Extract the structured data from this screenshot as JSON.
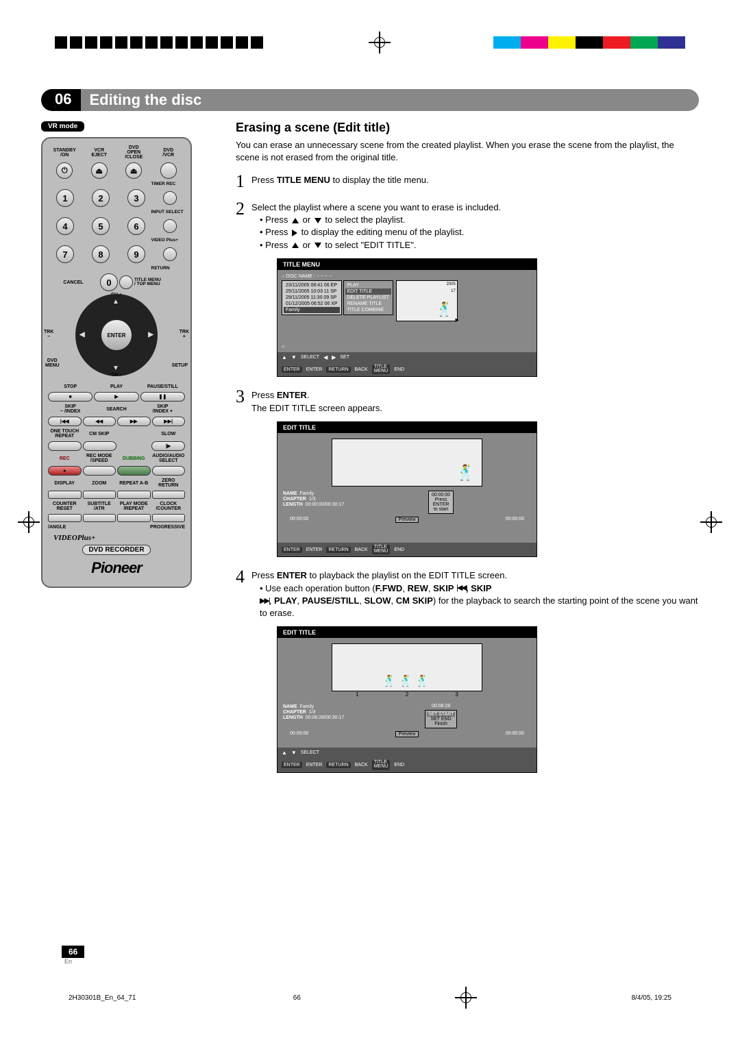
{
  "printmarks": {
    "colors": [
      "#00aeef",
      "#ec008c",
      "#fff200",
      "#000000",
      "#ed1c24",
      "#00a651",
      "#2e3192"
    ]
  },
  "chapter": {
    "num": "06",
    "title": "Editing the disc"
  },
  "mode_badge": "VR mode",
  "remote": {
    "row1_labels": [
      "STANDBY\n/ON",
      "VCR\nEJECT",
      "DVD\nOPEN\n/CLOSE",
      "DVD\n/VCR"
    ],
    "timer_rec": "TIMER REC",
    "input_select": "INPUT SELECT",
    "video_plus": "VIDEO Plus+",
    "return": "RETURN",
    "cancel": "CANCEL",
    "title_menu": "TITLE MENU\n/ TOP MENU",
    "ch_plus": "CH +",
    "ch_minus": "CH −",
    "trk_minus": "TRK\n−",
    "trk_plus": "TRK\n+",
    "enter": "ENTER",
    "dvd_menu": "DVD\nMENU",
    "setup": "SETUP",
    "stop": "STOP",
    "play": "PLAY",
    "pause": "PAUSE/STILL",
    "skip_l": "SKIP\n− /INDEX",
    "search_rew": "← REW",
    "search_fwd": "F.FWD →",
    "search": "SEARCH",
    "skip_r": "SKIP\n/INDEX +",
    "one_touch": "ONE TOUCH\nREPEAT",
    "cm_skip": "CM SKIP",
    "slow": "SLOW",
    "rec": "REC",
    "rec_mode": "REC MODE\n/SPEED",
    "dubbing": "DUBBING",
    "audio": "AUDIO/AUDIO\nSELECT",
    "row_labels_a": [
      "DISPLAY",
      "ZOOM",
      "REPEAT A-B",
      "ZERO RETURN"
    ],
    "row_labels_b": [
      "COUNTER\nRESET",
      "SUBTITLE\n/ATR",
      "PLAY MODE\n/REPEAT",
      "CLOCK\n/COUNTER"
    ],
    "angle": "/ANGLE",
    "progressive": "PROGRESSIVE",
    "videoplus_logo": "VIDEOPlus+",
    "dvd_recorder": "DVD RECORDER",
    "brand": "Pioneer"
  },
  "section": {
    "heading": "Erasing a scene (Edit title)",
    "intro": "You can erase an unnecessary scene from the created playlist. When you erase the scene from the playlist, the scene is not erased from the original title.",
    "steps": {
      "s1": {
        "num": "1",
        "text_a": "Press ",
        "bold": "TITLE MENU",
        "text_b": " to display the title menu."
      },
      "s2": {
        "num": "2",
        "line1": "Select the playlist where a scene you want to erase is included.",
        "b1a": "Press ",
        "b1b": " or ",
        "b1c": " to select the playlist.",
        "b2a": "Press ",
        "b2b": " to display the editing menu of the playlist.",
        "b3a": "Press ",
        "b3b": " or ",
        "b3c": " to select \"EDIT TITLE\"."
      },
      "s3": {
        "num": "3",
        "line_a": "Press ",
        "bold": "ENTER",
        "line_b": ".",
        "line2": "The EDIT TITLE screen appears."
      },
      "s4": {
        "num": "4",
        "l1a": "Press ",
        "l1b": "ENTER",
        "l1c": " to playback the playlist on the EDIT TITLE screen.",
        "b1a": "Use each operation button (",
        "b1b": "F.FWD",
        "b1c": ", ",
        "b1d": "REW",
        "b1e": ", ",
        "b1f": "SKIP",
        "b1g": ", SKIP",
        "b2a": ", ",
        "b2b": "PLAY",
        "b2c": ", ",
        "b2d": "PAUSE/STILL",
        "b2e": ", ",
        "b2f": "SLOW",
        "b2g": ", ",
        "b2h": "CM SKIP",
        "b2i": ") for the playback to search the starting point of the scene you want to erase."
      }
    }
  },
  "osd1": {
    "header": "TITLE MENU",
    "disc_name_label": "DISC NAME :",
    "disc_name": "− − − −",
    "list": [
      "23/11/2005 08:41 06 EP",
      "25/11/2005 10:03 11 SP",
      "29/11/2005 11:30 09 SP",
      "01/12/2005 06:52 06 XP",
      "Family"
    ],
    "submenu": [
      "PLAY",
      "EDIT TITLE",
      "DELETE PLAYLIST",
      "RENAME TITLE",
      "TITLE COMBINE"
    ],
    "thumb_meta": [
      "2005",
      "17"
    ],
    "footer": {
      "select": "SELECT",
      "set": "SET",
      "enter": "ENTER",
      "return": "RETURN",
      "back": "BACK",
      "titlemenu": "TITLE\nMENU",
      "end": "END"
    }
  },
  "osd2": {
    "header": "EDIT TITLE",
    "name_label": "NAME",
    "name": "Family",
    "chapter_label": "CHAPTER",
    "chapter": "1/3",
    "length_label": "LENGTH",
    "length": "00:00:00/00:30:17",
    "hint_time": "00:00:00",
    "hint_lines": [
      "Press",
      "ENTER",
      "to start"
    ],
    "left_time": "00:00:00",
    "preview": "Preview",
    "right_time": "00:00:00",
    "footer_enter": "ENTER",
    "footer_return": "RETURN",
    "footer_back": "BACK",
    "footer_tm": "TITLE\nMENU",
    "footer_end": "END"
  },
  "osd3": {
    "header": "EDIT TITLE",
    "name_label": "NAME",
    "name": "Family",
    "chapter_label": "CHAPTER",
    "chapter": "1/3",
    "length_label": "LENGTH",
    "length": "00:08:28/00:30:17",
    "marks": [
      "1",
      "2",
      "3"
    ],
    "hint_time": "00:08:28",
    "set_list": [
      "SET START",
      "SET END",
      "Finish"
    ],
    "left_time": "00:00:00",
    "preview": "Preview",
    "right_time": "00:00:00",
    "footer_select": "SELECT",
    "footer_enter": "ENTER",
    "footer_return": "RETURN",
    "footer_back": "BACK",
    "footer_tm": "TITLE\nMENU",
    "footer_end": "END"
  },
  "page_footer": {
    "page_num": "66",
    "lang": "En",
    "docid": "2H30301B_En_64_71",
    "sheet": "66",
    "date": "8/4/05, 19:25"
  }
}
